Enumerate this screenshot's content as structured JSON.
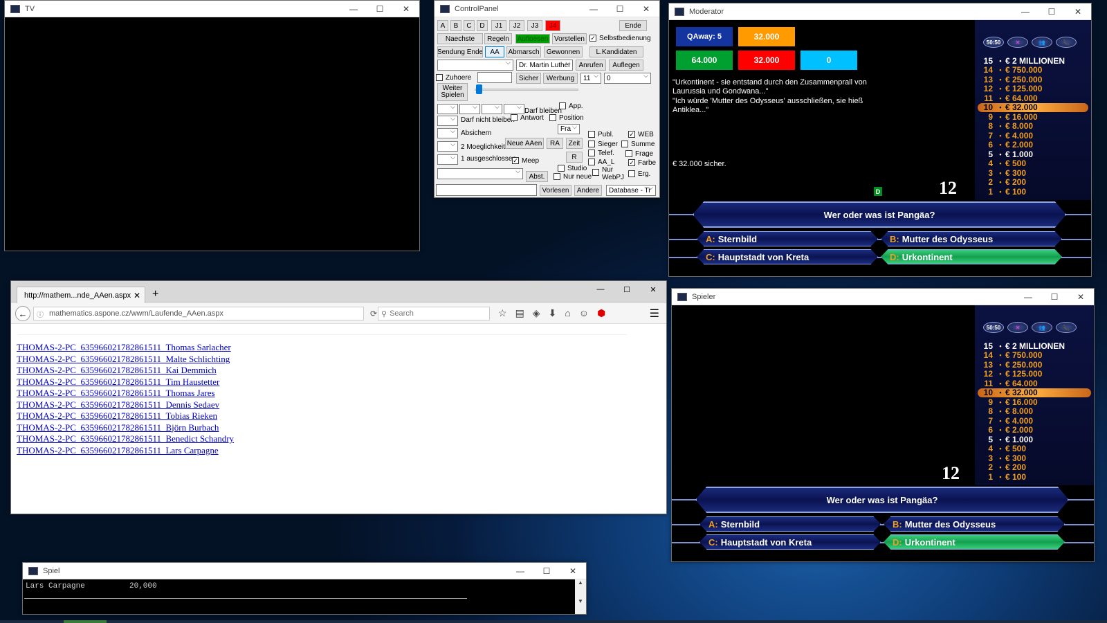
{
  "tv": {
    "title": "TV"
  },
  "controlpanel": {
    "title": "ControlPanel",
    "row1": [
      "A",
      "B",
      "C",
      "D",
      "J1",
      "J2",
      "J3",
      "J4"
    ],
    "ende": "Ende",
    "row2": {
      "naechste": "Naechste",
      "regeln": "Regeln",
      "aufloesen": "Aufloesen",
      "vorstellen": "Vorstellen",
      "selbst": "Selbstbedienung"
    },
    "row3": {
      "sendung_ende": "Sendung Ende",
      "aa": "AA",
      "abmarsch": "Abmarsch",
      "gewonnen": "Gewonnen",
      "lkandidaten": "L.Kandidaten"
    },
    "row4": {
      "doctor": "Dr. Martin Luther",
      "anrufen": "Anrufen",
      "auflegen": "Auflegen"
    },
    "row5": {
      "zuhoere": "Zuhoere",
      "sicher": "Sicher",
      "werbung": "Werbung",
      "num": "11",
      "zero": "0"
    },
    "weiter": "Weiter Spielen",
    "darf_bleiben": "Darf bleiben",
    "app": "App.",
    "darf_nicht": "Darf nicht bleiben",
    "antwort": "Antwort",
    "position": "Position",
    "fra": "Fra",
    "absichern": "Absichern",
    "publ": "Publ.",
    "web": "WEB",
    "moeglich": "2 Moeglichkeiten",
    "neue": "Neue AAen",
    "ra": "RA",
    "zeit": "Zeit",
    "sieger": "Sieger",
    "summe": "Summe",
    "telef": "Telef.",
    "frage": "Frage",
    "ausgeschl": "1 ausgeschlossen",
    "meep": "Meep",
    "r": "R",
    "aal": "AA_L",
    "farbe": "Farbe",
    "studio": "Studio",
    "nurneue": "Nur neue",
    "nurweb": "Nur WebPJ",
    "erg": "Erg.",
    "abst": "Abst.",
    "vorlesen": "Vorlesen",
    "andere": "Andere",
    "database": "Database - Tr"
  },
  "moderator": {
    "title": "Moderator",
    "qaway": "QAway: 5",
    "boxes": [
      "32.000",
      "64.000",
      "32.000",
      "0"
    ],
    "colors": {
      "blue": "#1434a0",
      "orange": "#ff9a00",
      "green": "#00a030",
      "red": "#ff0000",
      "cyan": "#00c0ff"
    },
    "note1": "\"Urkontinent - sie entstand durch den Zusammenprall von Laurussia und Gondwana...\"",
    "note2": "\"Ich würde 'Mutter des Odysseus' ausschließen, sie hieß Antiklea...\"",
    "secure": "€ 32.000 sicher.",
    "badge": "D",
    "timer": "12"
  },
  "game": {
    "lifelines": [
      "50:50",
      "✕",
      "👥",
      "📞"
    ],
    "ladder": [
      {
        "n": "15",
        "amt": "€ 2 MILLIONEN"
      },
      {
        "n": "14",
        "amt": "€ 750.000"
      },
      {
        "n": "13",
        "amt": "€ 250.000"
      },
      {
        "n": "12",
        "amt": "€ 125.000"
      },
      {
        "n": "11",
        "amt": "€ 64.000"
      },
      {
        "n": "10",
        "amt": "€ 32.000"
      },
      {
        "n": "9",
        "amt": "€ 16.000"
      },
      {
        "n": "8",
        "amt": "€ 8.000"
      },
      {
        "n": "7",
        "amt": "€ 4.000"
      },
      {
        "n": "6",
        "amt": "€ 2.000"
      },
      {
        "n": "5",
        "amt": "€ 1.000"
      },
      {
        "n": "4",
        "amt": "€ 500"
      },
      {
        "n": "3",
        "amt": "€ 300"
      },
      {
        "n": "2",
        "amt": "€ 200"
      },
      {
        "n": "1",
        "amt": "€ 100"
      }
    ],
    "question": "Wer oder was ist Pangäa?",
    "answers": {
      "A": "Sternbild",
      "B": "Mutter des Odysseus",
      "C": "Hauptstadt von Kreta",
      "D": "Urkontinent"
    },
    "labels": {
      "A": "A:",
      "B": "B:",
      "C": "C:",
      "D": "D:"
    }
  },
  "spieler": {
    "title": "Spieler",
    "timer": "12"
  },
  "browser": {
    "tab": "http://mathem...nde_AAen.aspx",
    "url": "mathematics.aspone.cz/wwm/Laufende_AAen.aspx",
    "search": "Search",
    "links": [
      "THOMAS-2-PC_635966021782861511_Thomas Sarlacher",
      "THOMAS-2-PC_635966021782861511_Malte Schlichting",
      "THOMAS-2-PC_635966021782861511_Kai Demmich",
      "THOMAS-2-PC_635966021782861511_Tim Haustetter",
      "THOMAS-2-PC_635966021782861511_Thomas Jares",
      "THOMAS-2-PC_635966021782861511_Dennis Sedaev",
      "THOMAS-2-PC_635966021782861511_Tobias Rieken",
      "THOMAS-2-PC_635966021782861511_Björn Burbach",
      "THOMAS-2-PC_635966021782861511_Benedict Schandry",
      "THOMAS-2-PC_635966021782861511_Lars Carpagne"
    ]
  },
  "spiel": {
    "title": "Spiel",
    "name": "Lars Carpagne",
    "score": "20,000"
  }
}
